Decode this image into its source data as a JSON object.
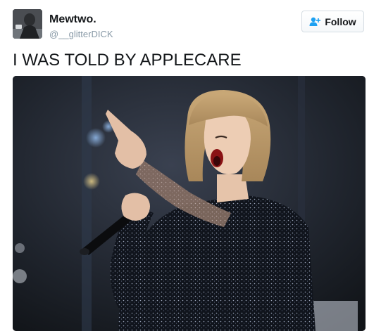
{
  "author": {
    "display_name": "Mewtwo.",
    "handle": "@__glitterDICK"
  },
  "follow_button": {
    "label": "Follow",
    "icon": "add-user-icon",
    "accent_color": "#1da1f2"
  },
  "tweet": {
    "text": "I WAS TOLD BY APPLECARE"
  },
  "media": {
    "kind": "photo",
    "subject": "performer-pointing-with-microphone"
  }
}
